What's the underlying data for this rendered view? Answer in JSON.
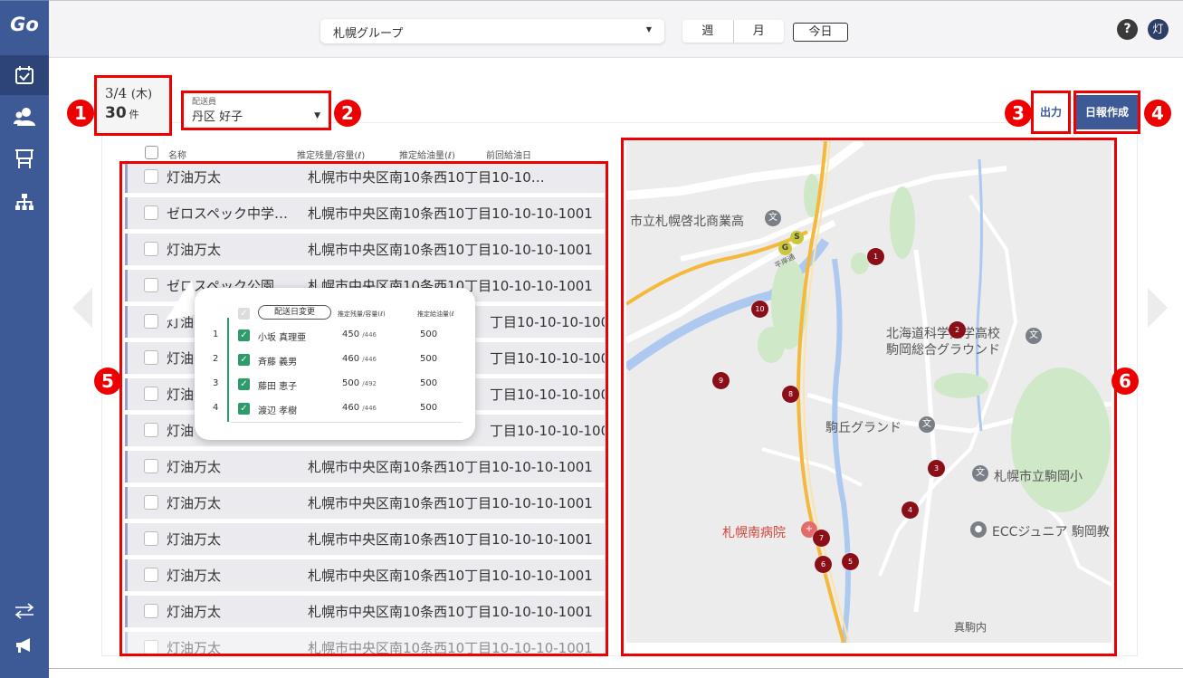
{
  "sidebar": {
    "logo": "Go"
  },
  "header": {
    "group_select": "札幌グループ",
    "views": [
      "週",
      "月"
    ],
    "today_label": "今日",
    "help_label": "?",
    "avatar_label": "灯"
  },
  "summary": {
    "date": "3/4",
    "weekday": "(木)",
    "count": "30",
    "count_unit": "件"
  },
  "driver": {
    "label": "配送員",
    "value": "丹区 好子"
  },
  "actions": {
    "output": "出力",
    "daily_report": "日報作成"
  },
  "table": {
    "headers": {
      "name": "名称",
      "remaining": "推定残量/容量(ℓ)",
      "supply": "推定給油量(ℓ)",
      "last": "前回給油日"
    },
    "rows": [
      {
        "name": "灯油万太",
        "address": "札幌市中央区南10条西10丁目10-10…"
      },
      {
        "name": "ゼロスペック中学…",
        "address": "札幌市中央区南10条西10丁目10-10-10-1001"
      },
      {
        "name": "灯油万太",
        "address": "札幌市中央区南10条西10丁目10-10-10-1001"
      },
      {
        "name": "ゼロスペック公園",
        "address": "札幌市中央区南10条西10丁目10-10-10-1001"
      },
      {
        "name": "灯油",
        "address": "丁目10-10-10-1001"
      },
      {
        "name": "灯油",
        "address": "丁目10-10-10-1001"
      },
      {
        "name": "灯油",
        "address": "丁目10-10-10-1001"
      },
      {
        "name": "灯油",
        "address": "丁目10-10-10-1001"
      },
      {
        "name": "灯油万太",
        "address": "札幌市中央区南10条西10丁目10-10-10-1001"
      },
      {
        "name": "灯油万太",
        "address": "札幌市中央区南10条西10丁目10-10-10-1001"
      },
      {
        "name": "灯油万太",
        "address": "札幌市中央区南10条西10丁目10-10-10-1001"
      },
      {
        "name": "灯油万太",
        "address": "札幌市中央区南10条西10丁目10-10-10-1001"
      },
      {
        "name": "灯油万太",
        "address": "札幌市中央区南10条西10丁目10-10-10-1001"
      },
      {
        "name": "灯油万太",
        "address": "札幌市中央区南10条西10丁目10-10-10-1001"
      }
    ]
  },
  "popup": {
    "button": "配送日変更",
    "headers": {
      "remaining": "推定残量/容量(ℓ)",
      "supply": "推定給油量(ℓ"
    },
    "rows": [
      {
        "idx": "1",
        "name": "小坂 真理亜",
        "remaining": "450",
        "capacity": "/446",
        "supply": "500"
      },
      {
        "idx": "2",
        "name": "斉藤 義男",
        "remaining": "460",
        "capacity": "/446",
        "supply": "500"
      },
      {
        "idx": "3",
        "name": "藤田 恵子",
        "remaining": "500",
        "capacity": "/492",
        "supply": "500"
      },
      {
        "idx": "4",
        "name": "渡辺 孝樹",
        "remaining": "460",
        "capacity": "/446",
        "supply": "500"
      }
    ]
  },
  "map": {
    "labels": {
      "school1": "市立札幌啓北商業高",
      "school2a": "北海道科学大学高校",
      "school2b": "駒岡総合グラウンド",
      "ground": "駒丘グランド",
      "school3": "札幌市立駒岡小",
      "hospital": "札幌南病院",
      "ecc": "ECCジュニア 駒岡教",
      "area": "真駒内",
      "road": "平岸通"
    },
    "pins": [
      "1",
      "2",
      "3",
      "4",
      "5",
      "6",
      "7",
      "8",
      "9",
      "10"
    ],
    "gpins": [
      "S",
      "G"
    ]
  },
  "annotations": [
    "1",
    "2",
    "3",
    "4",
    "5",
    "6"
  ],
  "colors": {
    "sidebar": "#3d5a96",
    "annotation": "#e00000",
    "pin": "#8b0f18",
    "check": "#2e9b6a"
  }
}
